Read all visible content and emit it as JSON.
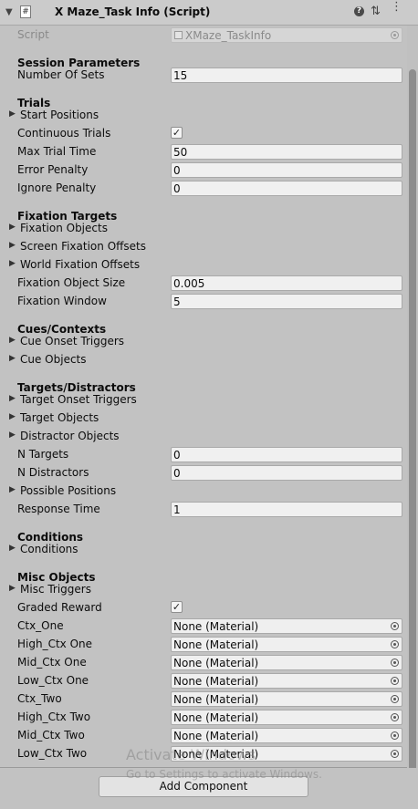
{
  "header": {
    "title": "X Maze_Task Info (Script)",
    "fold_glyph": "▼",
    "script_icon": "#",
    "help_glyph": "?",
    "preset_glyph": "⇅",
    "menu_glyph": "⋮"
  },
  "script": {
    "label": "Script",
    "value": "XMaze_TaskInfo"
  },
  "session": {
    "title": "Session Parameters",
    "number_of_sets": {
      "label": "Number Of Sets",
      "value": "15"
    }
  },
  "trials": {
    "title": "Trials",
    "start_positions": "Start Positions",
    "continuous_trials": {
      "label": "Continuous Trials",
      "checked": true,
      "glyph": "✓"
    },
    "max_trial_time": {
      "label": "Max Trial Time",
      "value": "50"
    },
    "error_penalty": {
      "label": "Error Penalty",
      "value": "0"
    },
    "ignore_penalty": {
      "label": "Ignore Penalty",
      "value": "0"
    }
  },
  "fixation": {
    "title": "Fixation Targets",
    "fixation_objects": "Fixation Objects",
    "screen_fixation_offsets": "Screen Fixation Offsets",
    "world_fixation_offsets": "World Fixation Offsets",
    "fixation_object_size": {
      "label": "Fixation Object Size",
      "value": "0.005"
    },
    "fixation_window": {
      "label": "Fixation Window",
      "value": "5"
    }
  },
  "cues": {
    "title": "Cues/Contexts",
    "cue_onset_triggers": "Cue Onset Triggers",
    "cue_objects": "Cue Objects"
  },
  "targets": {
    "title": "Targets/Distractors",
    "target_onset_triggers": "Target Onset Triggers",
    "target_objects": "Target Objects",
    "distractor_objects": "Distractor Objects",
    "n_targets": {
      "label": "N Targets",
      "value": "0"
    },
    "n_distractors": {
      "label": "N Distractors",
      "value": "0"
    },
    "possible_positions": "Possible Positions",
    "response_time": {
      "label": "Response Time",
      "value": "1"
    }
  },
  "conditions": {
    "title": "Conditions",
    "conditions": "Conditions"
  },
  "misc": {
    "title": "Misc Objects",
    "misc_triggers": "Misc Triggers",
    "graded_reward": {
      "label": "Graded Reward",
      "checked": true,
      "glyph": "✓"
    },
    "materials": [
      {
        "label": "Ctx_One",
        "value": "None (Material)"
      },
      {
        "label": "High_Ctx One",
        "value": "None (Material)"
      },
      {
        "label": "Mid_Ctx One",
        "value": "None (Material)"
      },
      {
        "label": "Low_Ctx One",
        "value": "None (Material)"
      },
      {
        "label": "Ctx_Two",
        "value": "None (Material)"
      },
      {
        "label": "High_Ctx Two",
        "value": "None (Material)"
      },
      {
        "label": "Mid_Ctx Two",
        "value": "None (Material)"
      },
      {
        "label": "Low_Ctx Two",
        "value": "None (Material)"
      }
    ]
  },
  "foldout_glyph": "▶",
  "add_component": "Add Component",
  "watermark": {
    "line1": "Activate Windows",
    "line2": "Go to Settings to activate Windows."
  }
}
